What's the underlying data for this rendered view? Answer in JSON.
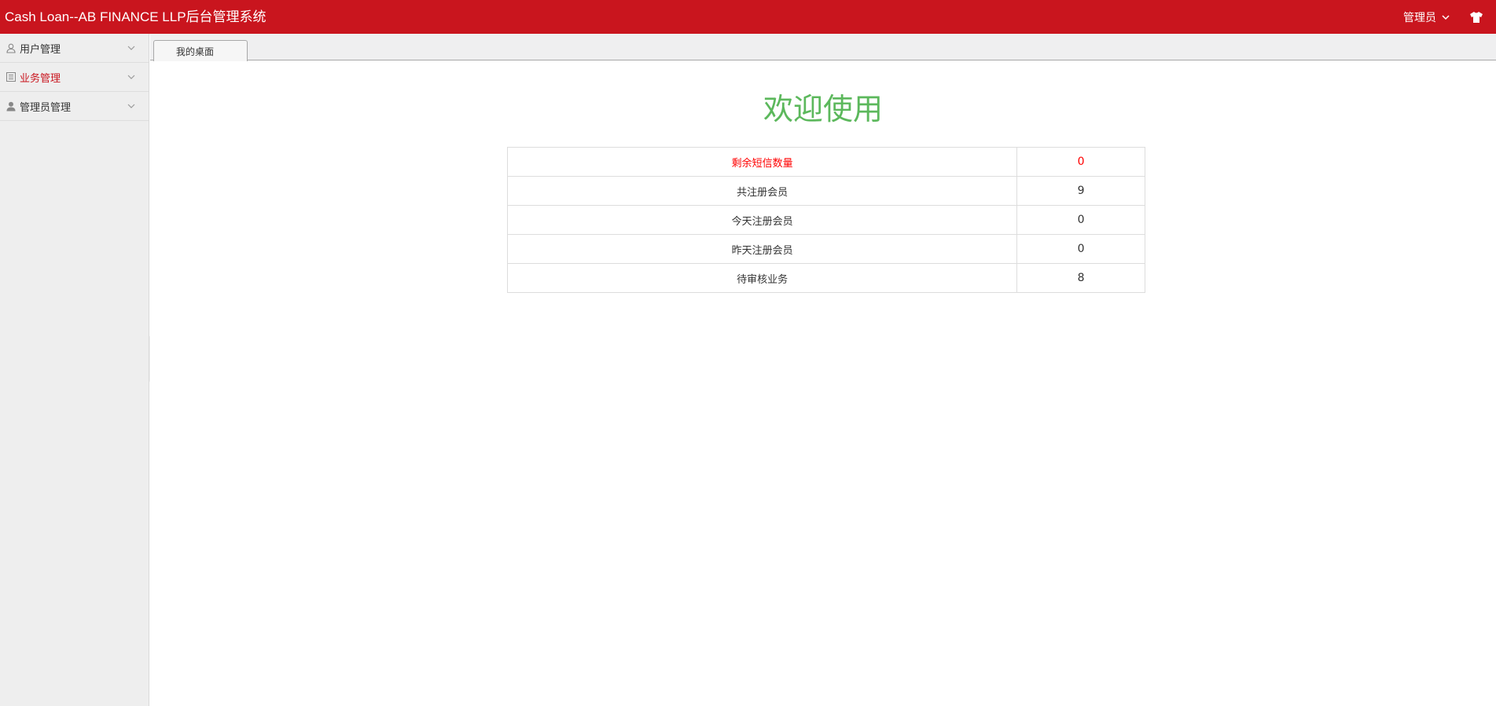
{
  "header": {
    "title": "Cash Loan--AB FINANCE LLP后台管理系统",
    "user_label": "管理员",
    "background": "#c9151e"
  },
  "sidebar": {
    "items": [
      {
        "label": "用户管理",
        "icon": "user-outline-icon",
        "active": false
      },
      {
        "label": "业务管理",
        "icon": "list-icon",
        "active": true
      },
      {
        "label": "管理员管理",
        "icon": "user-icon",
        "active": false
      }
    ]
  },
  "tabs": [
    {
      "label": "我的桌面",
      "active": true
    }
  ],
  "main": {
    "welcome": "欢迎使用",
    "welcome_color": "#5cb85c",
    "stats": [
      {
        "label": "剩余短信数量",
        "value": "0",
        "highlight": true
      },
      {
        "label": "共注册会员",
        "value": "9",
        "highlight": false
      },
      {
        "label": "今天注册会员",
        "value": "0",
        "highlight": false
      },
      {
        "label": "昨天注册会员",
        "value": "0",
        "highlight": false
      },
      {
        "label": "待审核业务",
        "value": "8",
        "highlight": false
      }
    ],
    "highlight_color": "#ff0000"
  }
}
